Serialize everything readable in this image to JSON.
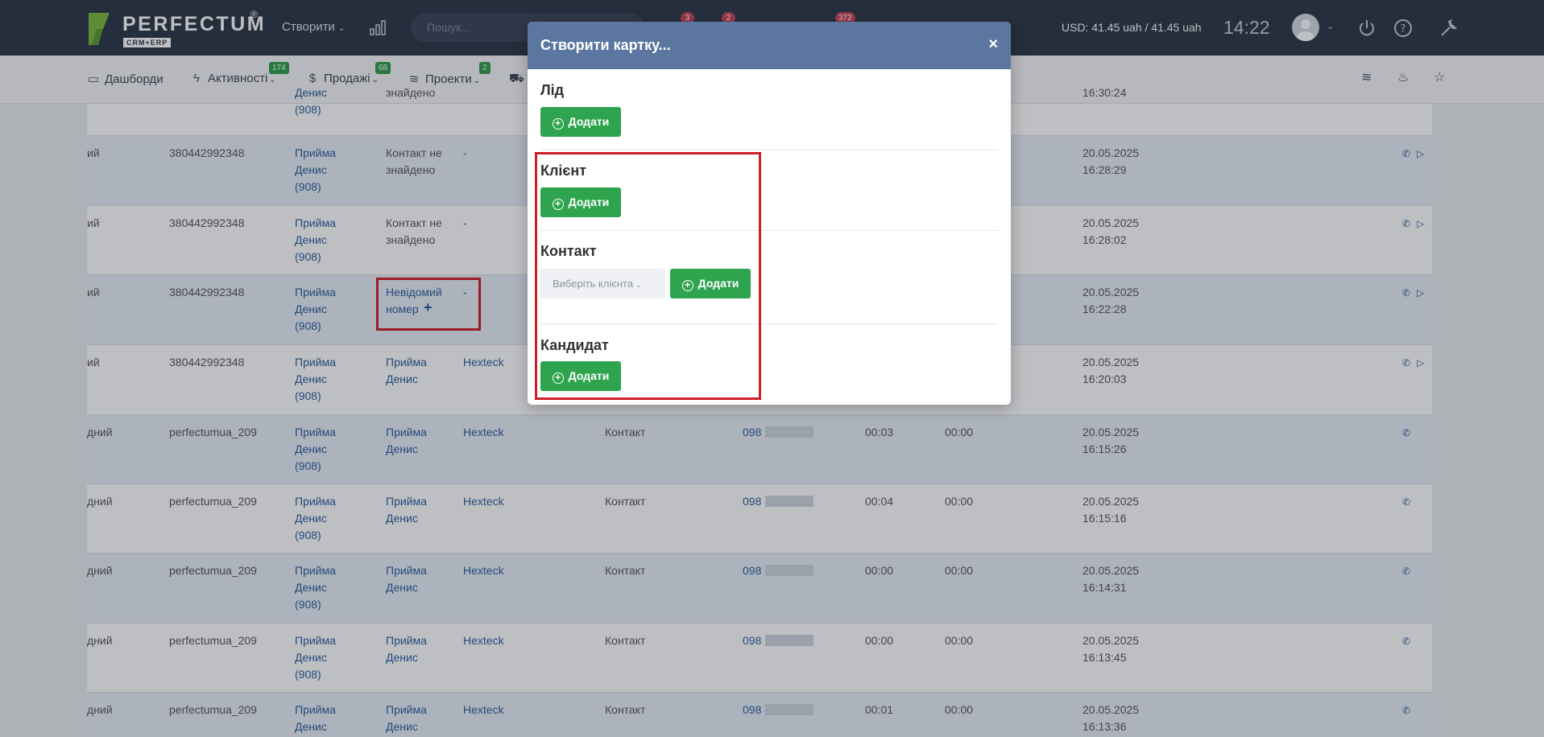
{
  "topbar": {
    "logo_text": "PERFECTUM",
    "logo_reg": "®",
    "logo_sub": "CRM+ERP",
    "create_label": "Створити",
    "search_placeholder": "Пошук...",
    "badges": [
      "3",
      "2",
      "372"
    ],
    "currency": "USD: 41.45 uah / 41.45 uah",
    "time": "14:22"
  },
  "nav": {
    "items": [
      {
        "label": "Дашборди",
        "icon": "monitor-icon"
      },
      {
        "label": "Активності",
        "badge": "174",
        "icon": "bolt-icon"
      },
      {
        "label": "Продажі",
        "badge": "68",
        "icon": "dollar-icon"
      },
      {
        "label": "Проекти",
        "badge": "2",
        "icon": "layers-icon"
      }
    ]
  },
  "table": {
    "rows": [
      {
        "c0": "",
        "c1": "",
        "c2": "Денис\n(908)",
        "c3": "знайдено",
        "c4": "",
        "c5": "",
        "c6": "",
        "c7": "",
        "c8": "",
        "c9": "16:30:24",
        "top_partial": true
      },
      {
        "c0": "ий",
        "c1": "380442992348",
        "c2": "Прийма\nДенис\n(908)",
        "c3": "Контакт не\nзнайдено",
        "c4": "-",
        "c5": "",
        "c6": "",
        "c7": "",
        "c8": "",
        "c9": "20.05.2025\n16:28:29",
        "alt": true,
        "play": true
      },
      {
        "c0": "ий",
        "c1": "380442992348",
        "c2": "Прийма\nДенис\n(908)",
        "c3": "Контакт не\nзнайдено",
        "c4": "-",
        "c5": "",
        "c6": "",
        "c7": "",
        "c8": "",
        "c9": "20.05.2025\n16:28:02",
        "play": true
      },
      {
        "c0": "ий",
        "c1": "380442992348",
        "c2": "Прийма\nДенис\n(908)",
        "c3": "Невідомий\nномер",
        "c4": "-",
        "c5": "",
        "c6": "",
        "c7": "",
        "c8": "",
        "c9": "20.05.2025\n16:22:28",
        "alt": true,
        "play": true,
        "unknown": true
      },
      {
        "c0": "ий",
        "c1": "380442992348",
        "c2": "Прийма\nДенис\n(908)",
        "c3": "Прийма\nДенис",
        "c4": "Hexteck",
        "c5": "",
        "c6": "",
        "c7": "",
        "c8": "",
        "c9": "20.05.2025\n16:20:03",
        "play": true
      },
      {
        "c0": "дний",
        "c1": "perfectumua_209",
        "c2": "Прийма\nДенис\n(908)",
        "c3": "Прийма\nДенис",
        "c4": "Hexteck",
        "c5": "Контакт",
        "c6": "098",
        "c7": "00:03",
        "c8": "00:00",
        "c9": "20.05.2025\n16:15:26",
        "alt": true
      },
      {
        "c0": "дний",
        "c1": "perfectumua_209",
        "c2": "Прийма\nДенис\n(908)",
        "c3": "Прийма\nДенис",
        "c4": "Hexteck",
        "c5": "Контакт",
        "c6": "098",
        "c7": "00:04",
        "c8": "00:00",
        "c9": "20.05.2025\n16:15:16"
      },
      {
        "c0": "дний",
        "c1": "perfectumua_209",
        "c2": "Прийма\nДенис\n(908)",
        "c3": "Прийма\nДенис",
        "c4": "Hexteck",
        "c5": "Контакт",
        "c6": "098",
        "c7": "00:00",
        "c8": "00:00",
        "c9": "20.05.2025\n16:14:31",
        "alt": true
      },
      {
        "c0": "дний",
        "c1": "perfectumua_209",
        "c2": "Прийма\nДенис\n(908)",
        "c3": "Прийма\nДенис",
        "c4": "Hexteck",
        "c5": "Контакт",
        "c6": "098",
        "c7": "00:00",
        "c8": "00:00",
        "c9": "20.05.2025\n16:13:45"
      },
      {
        "c0": "дний",
        "c1": "perfectumua_209",
        "c2": "Прийма\nДенис",
        "c3": "Прийма\nДенис",
        "c4": "Hexteck",
        "c5": "Контакт",
        "c6": "098",
        "c7": "00:01",
        "c8": "00:00",
        "c9": "20.05.2025\n16:13:36",
        "alt": true
      }
    ]
  },
  "modal": {
    "title": "Створити картку...",
    "close": "×",
    "sections": {
      "lead": "Лід",
      "client": "Клієнт",
      "contact": "Контакт",
      "candidate": "Кандидат"
    },
    "add_label": "Додати",
    "select_placeholder": "Виберіть клієнта"
  },
  "colors": {
    "topbar": "#2c3646",
    "modal_header": "#5b77a0",
    "add_button": "#2ea44f",
    "highlight": "#d11d23"
  }
}
